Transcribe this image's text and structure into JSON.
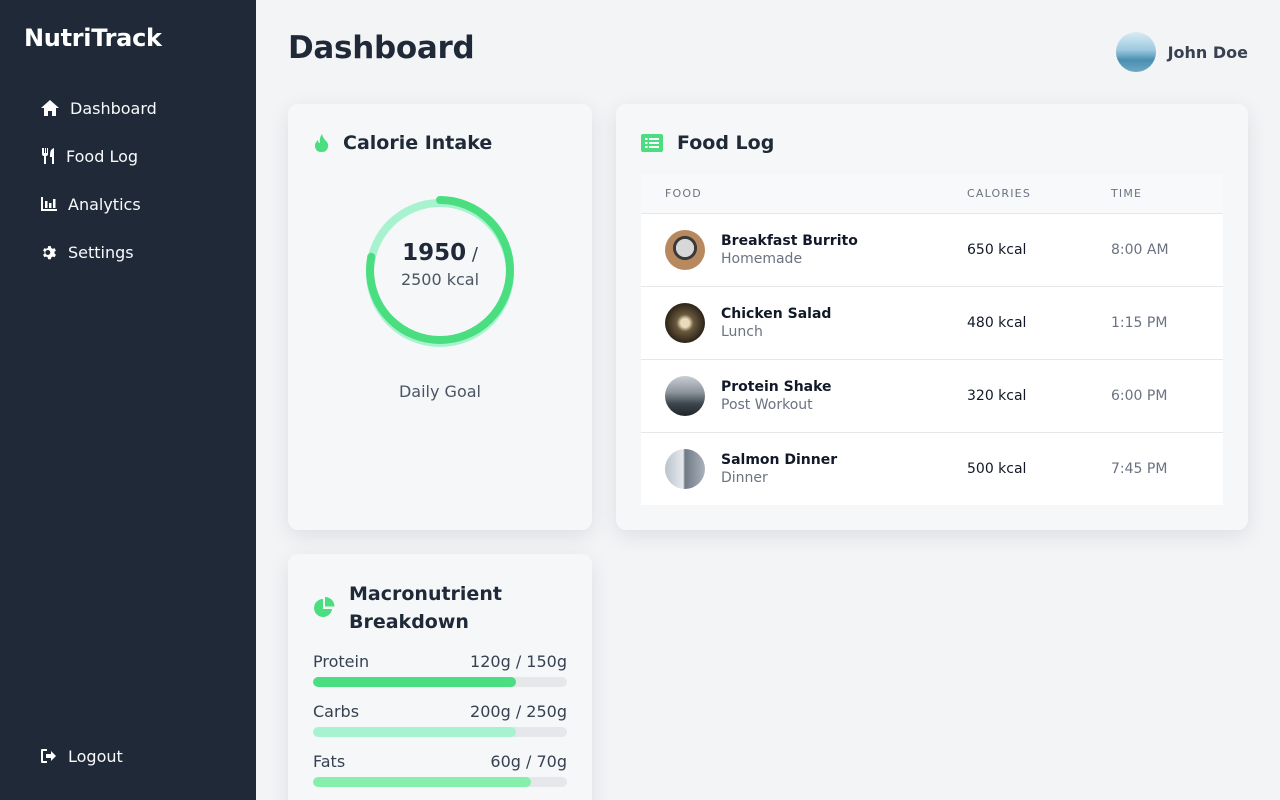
{
  "brand": "NutriTrack",
  "sidebar": {
    "items": [
      {
        "label": "Dashboard",
        "icon": "home-icon"
      },
      {
        "label": "Food Log",
        "icon": "utensils-icon"
      },
      {
        "label": "Analytics",
        "icon": "chart-icon"
      },
      {
        "label": "Settings",
        "icon": "gear-icon"
      }
    ],
    "logout": "Logout"
  },
  "header": {
    "title": "Dashboard",
    "user_name": "John Doe"
  },
  "calorie": {
    "title": "Calorie Intake",
    "consumed": "1950",
    "slash": " /",
    "goal_text": "2500 kcal",
    "progress": 0.78,
    "caption": "Daily Goal"
  },
  "food_log": {
    "title": "Food Log",
    "columns": [
      "FOOD",
      "CALORIES",
      "TIME"
    ],
    "rows": [
      {
        "name": "Breakfast Burrito",
        "sub": "Homemade",
        "calories": "650 kcal",
        "time": "8:00 AM"
      },
      {
        "name": "Chicken Salad",
        "sub": "Lunch",
        "calories": "480 kcal",
        "time": "1:15 PM"
      },
      {
        "name": "Protein Shake",
        "sub": "Post Workout",
        "calories": "320 kcal",
        "time": "6:00 PM"
      },
      {
        "name": "Salmon Dinner",
        "sub": "Dinner",
        "calories": "500 kcal",
        "time": "7:45 PM"
      }
    ]
  },
  "macros": {
    "title": "Macronutrient Breakdown",
    "items": [
      {
        "label": "Protein",
        "value": "120g / 150g",
        "progress": 0.8,
        "color": "#4ade80"
      },
      {
        "label": "Carbs",
        "value": "200g / 250g",
        "progress": 0.8,
        "color": "#a7f3d0"
      },
      {
        "label": "Fats",
        "value": "60g / 70g",
        "progress": 0.857,
        "color": "#86efac"
      }
    ]
  },
  "colors": {
    "accent": "#4ade80",
    "sidebar": "#1f2937"
  }
}
